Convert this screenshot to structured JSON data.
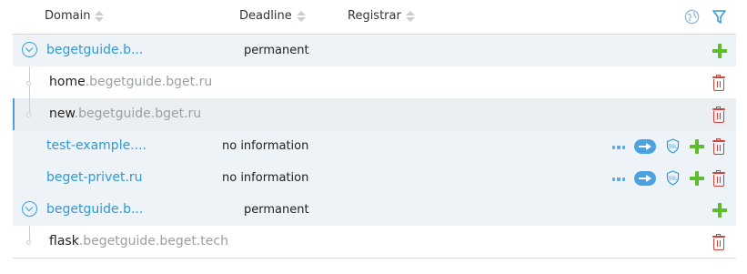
{
  "columns": {
    "domain": "Domain",
    "deadline": "Deadline",
    "registrar": "Registrar"
  },
  "header_icons": [
    "globe-icon",
    "filter-icon"
  ],
  "rows": [
    {
      "type": "domain",
      "name": "begetguide.b...",
      "deadline": "permanent",
      "expanded": true,
      "actions": [
        "add-subdomain"
      ]
    },
    {
      "type": "subdomain",
      "prefix": "home",
      "suffix": ".begetguide.bget.ru",
      "actions": [
        "delete"
      ]
    },
    {
      "type": "subdomain",
      "prefix": "new",
      "suffix": ".begetguide.bget.ru",
      "selected": true,
      "actions": [
        "delete"
      ]
    },
    {
      "type": "domain",
      "name": "test-example....",
      "deadline": "no information",
      "actions": [
        "more",
        "redirect",
        "ssl",
        "add-subdomain",
        "delete"
      ]
    },
    {
      "type": "domain",
      "name": "beget-privet.ru",
      "deadline": "no information",
      "actions": [
        "more",
        "redirect",
        "ssl",
        "add-subdomain",
        "delete"
      ]
    },
    {
      "type": "domain",
      "name": "begetguide.b...",
      "deadline": "permanent",
      "expanded": true,
      "actions": [
        "add-subdomain"
      ]
    },
    {
      "type": "subdomain",
      "prefix": "flask",
      "suffix": ".begetguide.beget.tech",
      "actions": [
        "delete"
      ]
    }
  ],
  "colors": {
    "accent": "#2f9ad6",
    "add": "#5dbb2c",
    "delete": "#d0433c",
    "row_highlight": "#eef3f8"
  }
}
